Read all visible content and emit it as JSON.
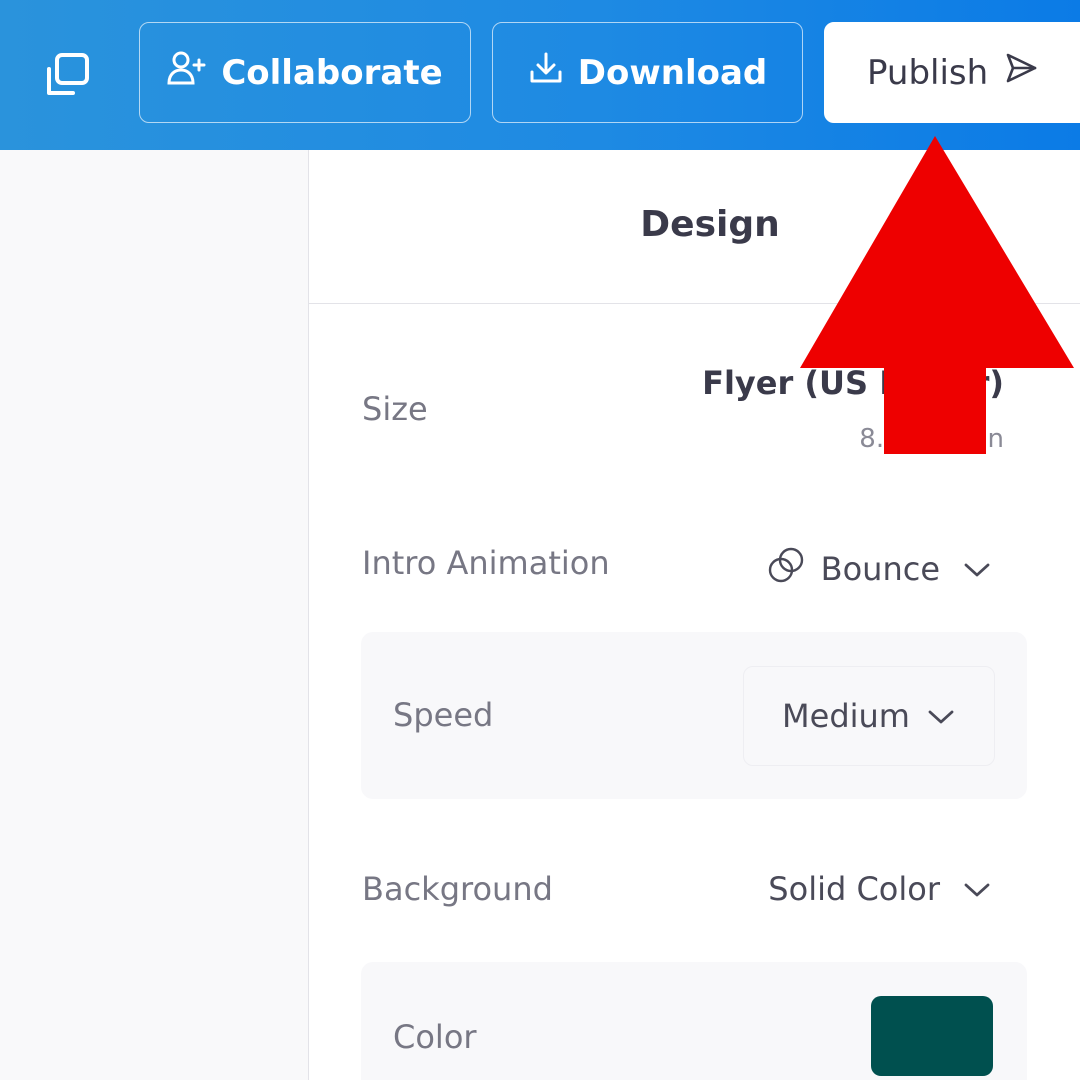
{
  "topbar": {
    "collaborate_label": "Collaborate",
    "download_label": "Download",
    "publish_label": "Publish",
    "gradient_start": "#2a93dc",
    "gradient_end": "#0b7be6"
  },
  "panel": {
    "title": "Design",
    "size": {
      "label": "Size",
      "name": "Flyer (US Letter)",
      "dimensions": "8.5 × 11 in"
    },
    "intro_animation": {
      "label": "Intro Animation",
      "value": "Bounce"
    },
    "speed": {
      "label": "Speed",
      "value": "Medium"
    },
    "background": {
      "label": "Background",
      "value": "Solid Color"
    },
    "color": {
      "label": "Color",
      "swatch": "#00504f"
    }
  },
  "annotation": {
    "arrow_color": "#ee0000"
  },
  "icons": [
    "duplicate-icon",
    "add-user-icon",
    "download-icon",
    "send-icon",
    "animation-circles-icon",
    "chevron-down-icon"
  ]
}
